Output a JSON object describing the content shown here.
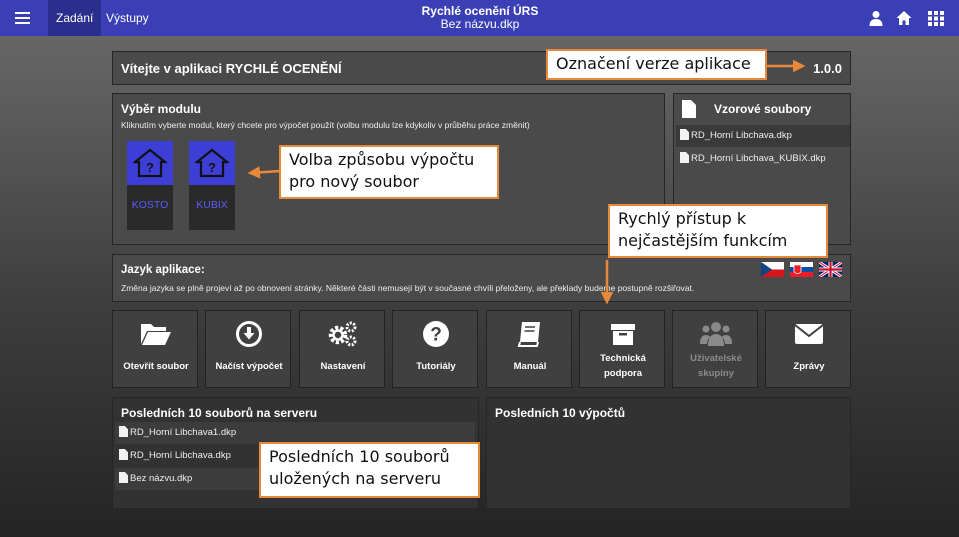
{
  "topbar": {
    "tabs": [
      {
        "label": "Zadání"
      },
      {
        "label": "Výstupy"
      }
    ],
    "app_title": "Rychlé ocenění ÚRS",
    "file_name": "Bez názvu.dkp",
    "icons": [
      "user-icon",
      "home-icon",
      "grid-icon"
    ]
  },
  "welcome": {
    "text": "Vítejte v aplikaci RYCHLÉ OCENĚNÍ",
    "version": "1.0.0"
  },
  "module": {
    "title": "Výběr modulu",
    "subtitle": "Kliknutím vyberte modul, který chcete pro výpočet použít (volbu modulu lze kdykoliv v průběhu práce změnit)",
    "modules": [
      {
        "label": "KOSTO"
      },
      {
        "label": "KUBIX"
      }
    ]
  },
  "samples": {
    "title": "Vzorové soubory",
    "items": [
      "RD_Horní Libchava.dkp",
      "RD_Horní Libchava_KUBIX.dkp"
    ]
  },
  "language": {
    "title": "Jazyk aplikace:",
    "subtitle": "Změna jazyka se plně projeví až po obnovení stránky. Některé části nemusejí být v současné chvíli přeloženy, ale překlady budeme postupně rozšiřovat.",
    "flags": [
      "czech-flag-icon",
      "slovak-flag-icon",
      "uk-flag-icon"
    ]
  },
  "tiles": [
    {
      "label": "Otevřít soubor",
      "icon": "folder-open-icon"
    },
    {
      "label": "Načíst výpočet",
      "icon": "download-circle-icon"
    },
    {
      "label": "Nastavení",
      "icon": "gears-icon"
    },
    {
      "label": "Tutoriály",
      "icon": "question-circle-icon"
    },
    {
      "label": "Manuál",
      "icon": "book-icon"
    },
    {
      "label": "Technická podpora",
      "icon": "archive-box-icon"
    },
    {
      "label": "Uživatelské skupiny",
      "icon": "users-icon"
    },
    {
      "label": "Zprávy",
      "icon": "envelope-icon"
    }
  ],
  "recent_files": {
    "title": "Posledních 10 souborů na serveru",
    "items": [
      "RD_Horní Libchava1.dkp",
      "RD_Horní Libchava.dkp",
      "Bez názvu.dkp"
    ]
  },
  "recent_calcs": {
    "title": "Posledních 10 výpočtů"
  },
  "callouts": {
    "version": "Označení verze aplikace",
    "module": "Volba způsobu výpočtu\npro nový soubor",
    "quick": "Rychlý přístup k\nnejčastějším funkcím",
    "recent": "Posledních 10 souborů\nuložených na serveru"
  },
  "colors": {
    "topbar": "#3a3fb5",
    "active_tab": "#2a2e8c",
    "module_tile": "#3d3ed6",
    "callout_border": "#e8893a"
  }
}
